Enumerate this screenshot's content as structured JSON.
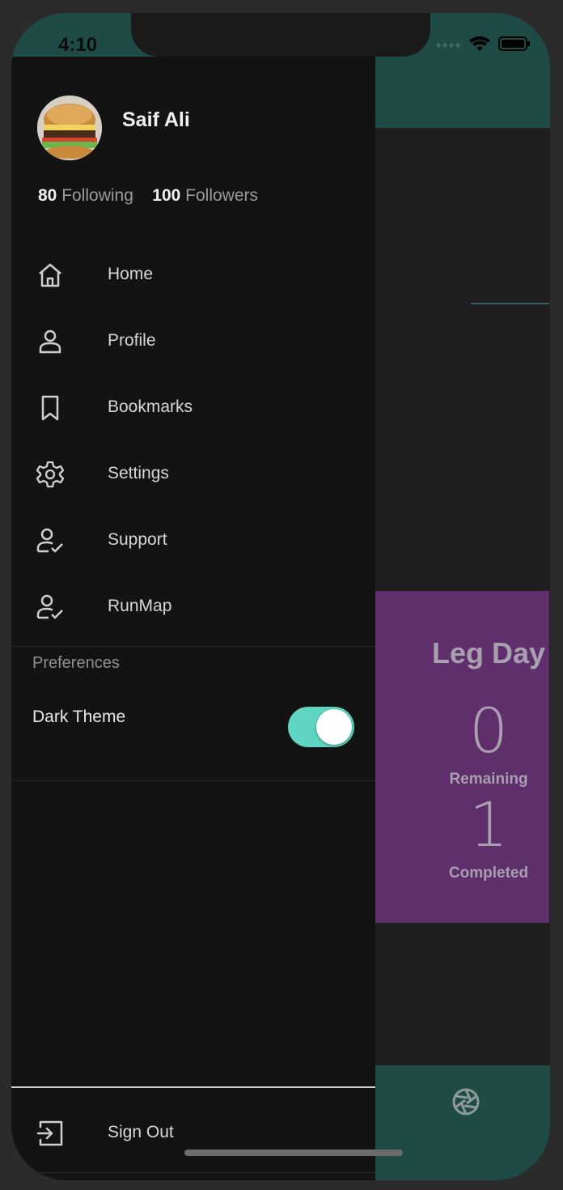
{
  "status_bar": {
    "time": "4:10",
    "signal_icon": "signal-dots-icon",
    "wifi_icon": "wifi-icon",
    "battery_icon": "battery-icon"
  },
  "background_app": {
    "leg_day_card": {
      "title": "Leg Day",
      "remaining_value": "0",
      "remaining_label": "Remaining",
      "completed_value": "1",
      "completed_label": "Completed"
    },
    "bottom_icon": "aperture-icon",
    "colors": {
      "header": "#1e4b45",
      "card": "#5e2f6a"
    }
  },
  "drawer": {
    "user": {
      "name": "Saif Ali",
      "following_count": "80",
      "following_label": "Following",
      "followers_count": "100",
      "followers_label": "Followers"
    },
    "nav_items": [
      {
        "label": "Home",
        "icon": "home-icon"
      },
      {
        "label": "Profile",
        "icon": "person-icon"
      },
      {
        "label": "Bookmarks",
        "icon": "bookmark-icon"
      },
      {
        "label": "Settings",
        "icon": "gear-icon"
      },
      {
        "label": "Support",
        "icon": "person-check-icon"
      },
      {
        "label": "RunMap",
        "icon": "person-check-icon"
      }
    ],
    "preferences": {
      "section_title": "Preferences",
      "dark_theme_label": "Dark Theme",
      "dark_theme_on": true,
      "toggle_color": "#5ed6c2"
    },
    "sign_out": {
      "label": "Sign Out",
      "icon": "sign-out-icon"
    }
  }
}
